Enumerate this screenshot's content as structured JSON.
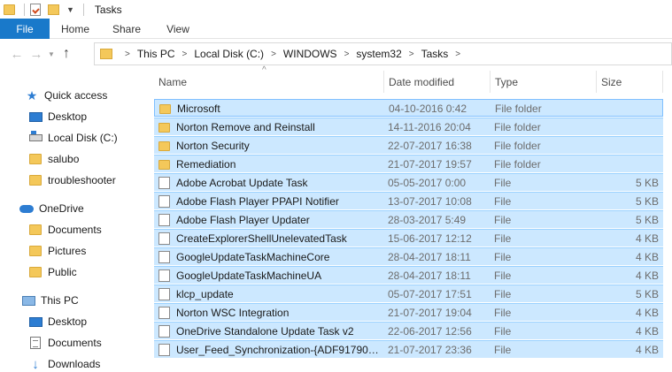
{
  "window": {
    "title": "Tasks"
  },
  "ribbon": {
    "tabs": [
      {
        "label": "File"
      },
      {
        "label": "Home"
      },
      {
        "label": "Share"
      },
      {
        "label": "View"
      }
    ]
  },
  "address": {
    "crumbs": [
      "This PC",
      "Local Disk (C:)",
      "WINDOWS",
      "system32",
      "Tasks"
    ]
  },
  "sidebar": {
    "items": [
      {
        "label": "Quick access",
        "icon": "star-icon"
      },
      {
        "label": "Desktop",
        "icon": "desktop-icon"
      },
      {
        "label": "Local Disk (C:)",
        "icon": "drive-icon"
      },
      {
        "label": "salubo",
        "icon": "folder-icon"
      },
      {
        "label": "troubleshooter",
        "icon": "folder-icon"
      },
      {
        "label": "OneDrive",
        "icon": "cloud-icon"
      },
      {
        "label": "Documents",
        "icon": "folder-icon"
      },
      {
        "label": "Pictures",
        "icon": "folder-icon"
      },
      {
        "label": "Public",
        "icon": "folder-icon"
      },
      {
        "label": "This PC",
        "icon": "pc-icon"
      },
      {
        "label": "Desktop",
        "icon": "desktop-icon"
      },
      {
        "label": "Documents",
        "icon": "documents-icon"
      },
      {
        "label": "Downloads",
        "icon": "download-icon"
      }
    ]
  },
  "table": {
    "columns": [
      "Name",
      "Date modified",
      "Type",
      "Size"
    ],
    "rows": [
      {
        "name": "Microsoft",
        "date": "04-10-2016 0:42",
        "type": "File folder",
        "size": "",
        "kind": "folder"
      },
      {
        "name": "Norton Remove and Reinstall",
        "date": "14-11-2016 20:04",
        "type": "File folder",
        "size": "",
        "kind": "folder"
      },
      {
        "name": "Norton Security",
        "date": "22-07-2017 16:38",
        "type": "File folder",
        "size": "",
        "kind": "folder"
      },
      {
        "name": "Remediation",
        "date": "21-07-2017 19:57",
        "type": "File folder",
        "size": "",
        "kind": "folder"
      },
      {
        "name": "Adobe Acrobat Update Task",
        "date": "05-05-2017 0:00",
        "type": "File",
        "size": "5 KB",
        "kind": "file"
      },
      {
        "name": "Adobe Flash Player PPAPI Notifier",
        "date": "13-07-2017 10:08",
        "type": "File",
        "size": "5 KB",
        "kind": "file"
      },
      {
        "name": "Adobe Flash Player Updater",
        "date": "28-03-2017 5:49",
        "type": "File",
        "size": "5 KB",
        "kind": "file"
      },
      {
        "name": "CreateExplorerShellUnelevatedTask",
        "date": "15-06-2017 12:12",
        "type": "File",
        "size": "4 KB",
        "kind": "file"
      },
      {
        "name": "GoogleUpdateTaskMachineCore",
        "date": "28-04-2017 18:11",
        "type": "File",
        "size": "4 KB",
        "kind": "file"
      },
      {
        "name": "GoogleUpdateTaskMachineUA",
        "date": "28-04-2017 18:11",
        "type": "File",
        "size": "4 KB",
        "kind": "file"
      },
      {
        "name": "klcp_update",
        "date": "05-07-2017 17:51",
        "type": "File",
        "size": "5 KB",
        "kind": "file"
      },
      {
        "name": "Norton WSC Integration",
        "date": "21-07-2017 19:04",
        "type": "File",
        "size": "4 KB",
        "kind": "file"
      },
      {
        "name": "OneDrive Standalone Update Task v2",
        "date": "22-06-2017 12:56",
        "type": "File",
        "size": "4 KB",
        "kind": "file"
      },
      {
        "name": "User_Feed_Synchronization-{ADF91790-B...",
        "date": "21-07-2017 23:36",
        "type": "File",
        "size": "4 KB",
        "kind": "file"
      }
    ]
  },
  "colors": {
    "accent": "#1979ca",
    "selection": "#cce8ff",
    "selection_border": "#99d1ff",
    "folder": "#f4c85a"
  }
}
